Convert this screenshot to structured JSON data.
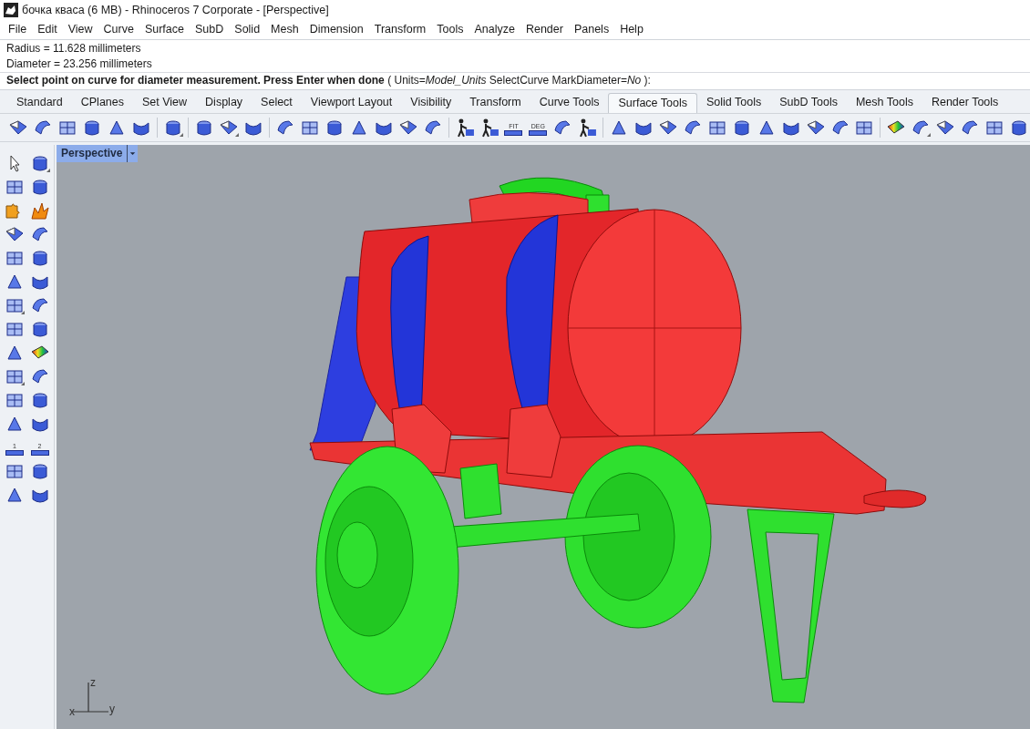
{
  "window": {
    "title": "бочка кваса (6 MB) - Rhinoceros 7 Corporate - [Perspective]"
  },
  "menu": [
    "File",
    "Edit",
    "View",
    "Curve",
    "Surface",
    "SubD",
    "Solid",
    "Mesh",
    "Dimension",
    "Transform",
    "Tools",
    "Analyze",
    "Render",
    "Panels",
    "Help"
  ],
  "command_history": [
    "Radius = 11.628 millimeters",
    "Diameter = 23.256 millimeters"
  ],
  "command_prompt": "**Select point on curve for diameter measurement. Press Enter when done** ( Units=*Model_Units*  SelectCurve  MarkDiameter=*No* ):",
  "toolbar_tabs": [
    {
      "label": "Standard",
      "selected": false
    },
    {
      "label": "CPlanes",
      "selected": false
    },
    {
      "label": "Set View",
      "selected": false
    },
    {
      "label": "Display",
      "selected": false
    },
    {
      "label": "Select",
      "selected": false
    },
    {
      "label": "Viewport Layout",
      "selected": false
    },
    {
      "label": "Visibility",
      "selected": false
    },
    {
      "label": "Transform",
      "selected": false
    },
    {
      "label": "Curve Tools",
      "selected": false
    },
    {
      "label": "Surface Tools",
      "selected": true
    },
    {
      "label": "Solid Tools",
      "selected": false
    },
    {
      "label": "SubD Tools",
      "selected": false
    },
    {
      "label": "Mesh Tools",
      "selected": false
    },
    {
      "label": "Render Tools",
      "selected": false
    }
  ],
  "toolbar": [
    {
      "kind": "tool"
    },
    {
      "kind": "tool"
    },
    {
      "kind": "tool"
    },
    {
      "kind": "tool"
    },
    {
      "kind": "tool"
    },
    {
      "kind": "tool"
    },
    {
      "kind": "separator"
    },
    {
      "kind": "menu_tool"
    },
    {
      "kind": "separator"
    },
    {
      "kind": "tool"
    },
    {
      "kind": "menu_tool"
    },
    {
      "kind": "tool"
    },
    {
      "kind": "separator"
    },
    {
      "kind": "tool"
    },
    {
      "kind": "tool"
    },
    {
      "kind": "tool"
    },
    {
      "kind": "tool"
    },
    {
      "kind": "tool"
    },
    {
      "kind": "tool"
    },
    {
      "kind": "tool"
    },
    {
      "kind": "separator"
    },
    {
      "kind": "person_tool"
    },
    {
      "kind": "person_tool"
    },
    {
      "kind": "label_tool",
      "label": "FIT"
    },
    {
      "kind": "label_tool",
      "label": "DEG"
    },
    {
      "kind": "tool"
    },
    {
      "kind": "person_tool"
    },
    {
      "kind": "separator"
    },
    {
      "kind": "tool"
    },
    {
      "kind": "tool"
    },
    {
      "kind": "tool"
    },
    {
      "kind": "tool"
    },
    {
      "kind": "tool"
    },
    {
      "kind": "tool"
    },
    {
      "kind": "tool"
    },
    {
      "kind": "tool"
    },
    {
      "kind": "tool"
    },
    {
      "kind": "tool"
    },
    {
      "kind": "tool"
    },
    {
      "kind": "separator"
    },
    {
      "kind": "rainbow_tool"
    },
    {
      "kind": "menu_tool"
    },
    {
      "kind": "tool"
    },
    {
      "kind": "tool"
    },
    {
      "kind": "tool"
    },
    {
      "kind": "tool"
    }
  ],
  "side_toolbar": [
    {
      "kind": "arrow_tool"
    },
    {
      "kind": "menu_tool"
    },
    {
      "kind": "tool"
    },
    {
      "kind": "tool"
    },
    {
      "kind": "puzzle_tool"
    },
    {
      "kind": "burst_tool"
    },
    {
      "kind": "tool"
    },
    {
      "kind": "tool"
    },
    {
      "kind": "tool"
    },
    {
      "kind": "tool"
    },
    {
      "kind": "tool"
    },
    {
      "kind": "tool"
    },
    {
      "kind": "menu_tool"
    },
    {
      "kind": "tool"
    },
    {
      "kind": "tool"
    },
    {
      "kind": "tool"
    },
    {
      "kind": "tool"
    },
    {
      "kind": "rainbow_tool"
    },
    {
      "kind": "menu_tool"
    },
    {
      "kind": "tool"
    },
    {
      "kind": "tool"
    },
    {
      "kind": "tool"
    },
    {
      "kind": "tool"
    },
    {
      "kind": "tool"
    },
    {
      "kind": "label_tool",
      "label": "1"
    },
    {
      "kind": "label_tool",
      "label": "2"
    },
    {
      "kind": "tool"
    },
    {
      "kind": "tool"
    },
    {
      "kind": "tool"
    },
    {
      "kind": "tool"
    }
  ],
  "viewport": {
    "label": "Perspective",
    "axes": {
      "x": "x",
      "y": "y",
      "z": "z"
    }
  }
}
